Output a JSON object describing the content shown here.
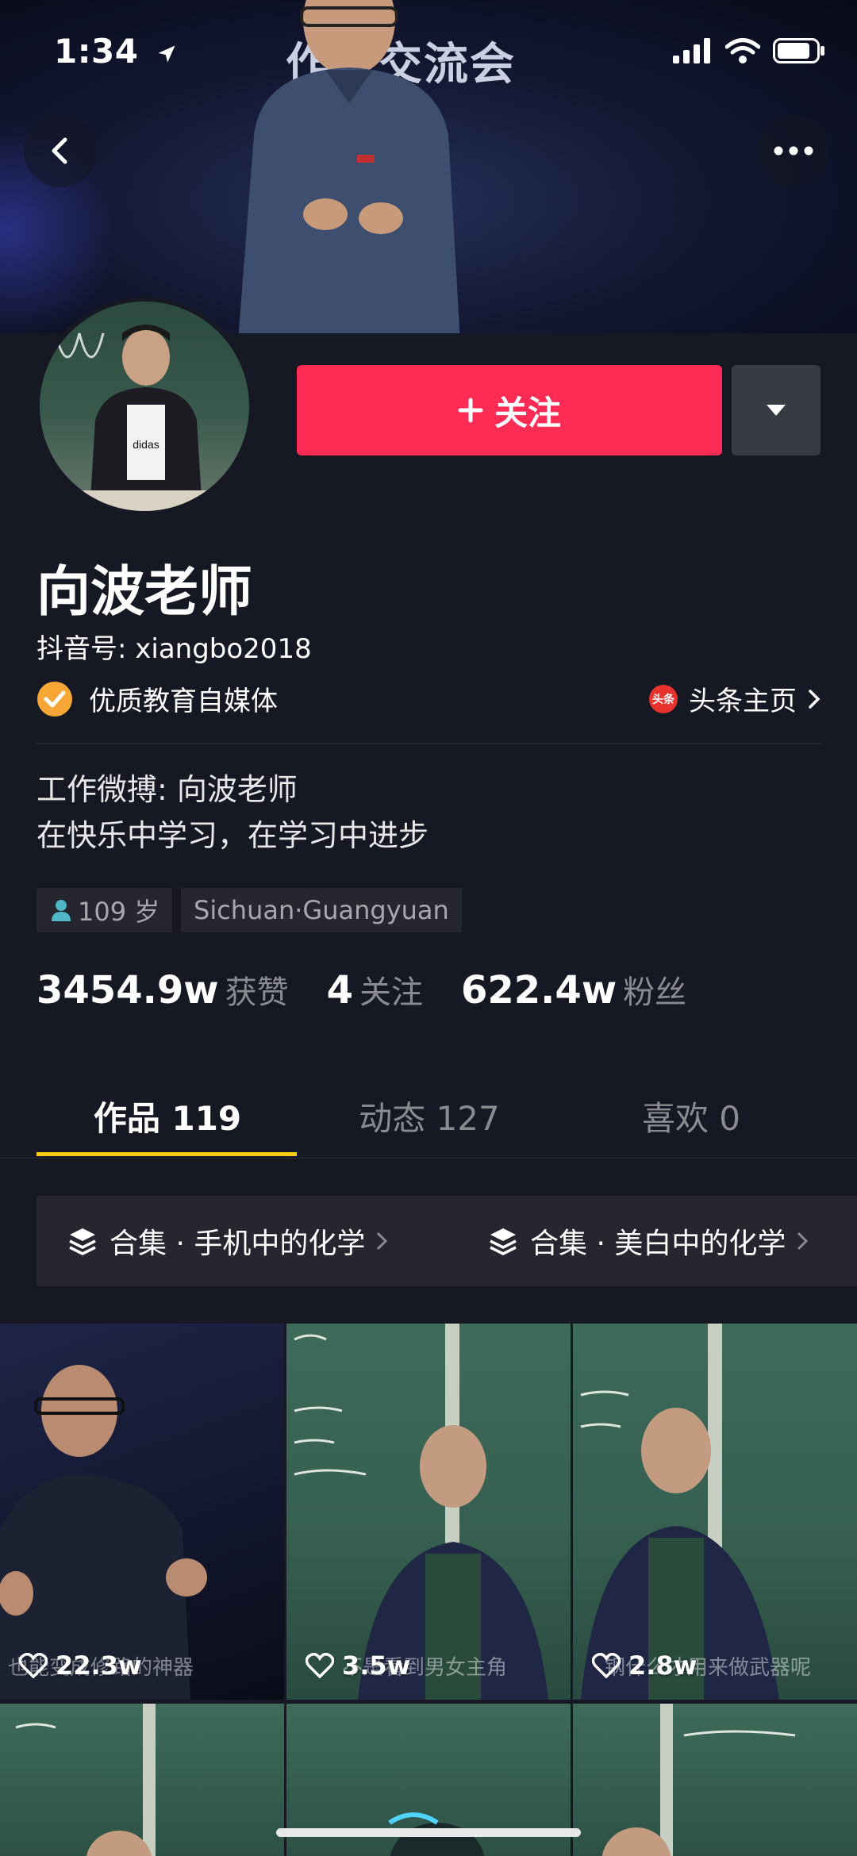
{
  "status_bar": {
    "time": "1:34"
  },
  "banner": {
    "stage_text": "作者交流会"
  },
  "profile": {
    "follow_label": "关注",
    "name": "向波老师",
    "douyin_id": "抖音号: xiangbo2018",
    "verified_label": "优质教育自媒体",
    "toutiao_badge": "头条",
    "toutiao_label": "头条主页",
    "bio_line1": "工作微搏: 向波老师",
    "bio_line2": "在快乐中学习，在学习中进步",
    "tags": {
      "age": "109 岁",
      "location": "Sichuan·Guangyuan"
    },
    "stats": [
      {
        "value": "3454.9w",
        "label": "获赞"
      },
      {
        "value": "4",
        "label": "关注"
      },
      {
        "value": "622.4w",
        "label": "粉丝"
      }
    ]
  },
  "tabs": [
    {
      "label": "作品 119"
    },
    {
      "label": "动态 127"
    },
    {
      "label": "喜欢 0"
    }
  ],
  "collections": [
    {
      "label": "合集 · 手机中的化学"
    },
    {
      "label": "合集 · 美白中的化学"
    }
  ],
  "videos": [
    {
      "likes": "22.3w",
      "caption": "也能变成修路的神器"
    },
    {
      "likes": "3.5w",
      "caption": "不是看到男女主角"
    },
    {
      "likes": "2.8w",
      "caption": "钢什么才用来做武器呢"
    }
  ],
  "colors": {
    "follow": "#fe2c55",
    "tab_underline": "#face15",
    "background": "#161823"
  }
}
